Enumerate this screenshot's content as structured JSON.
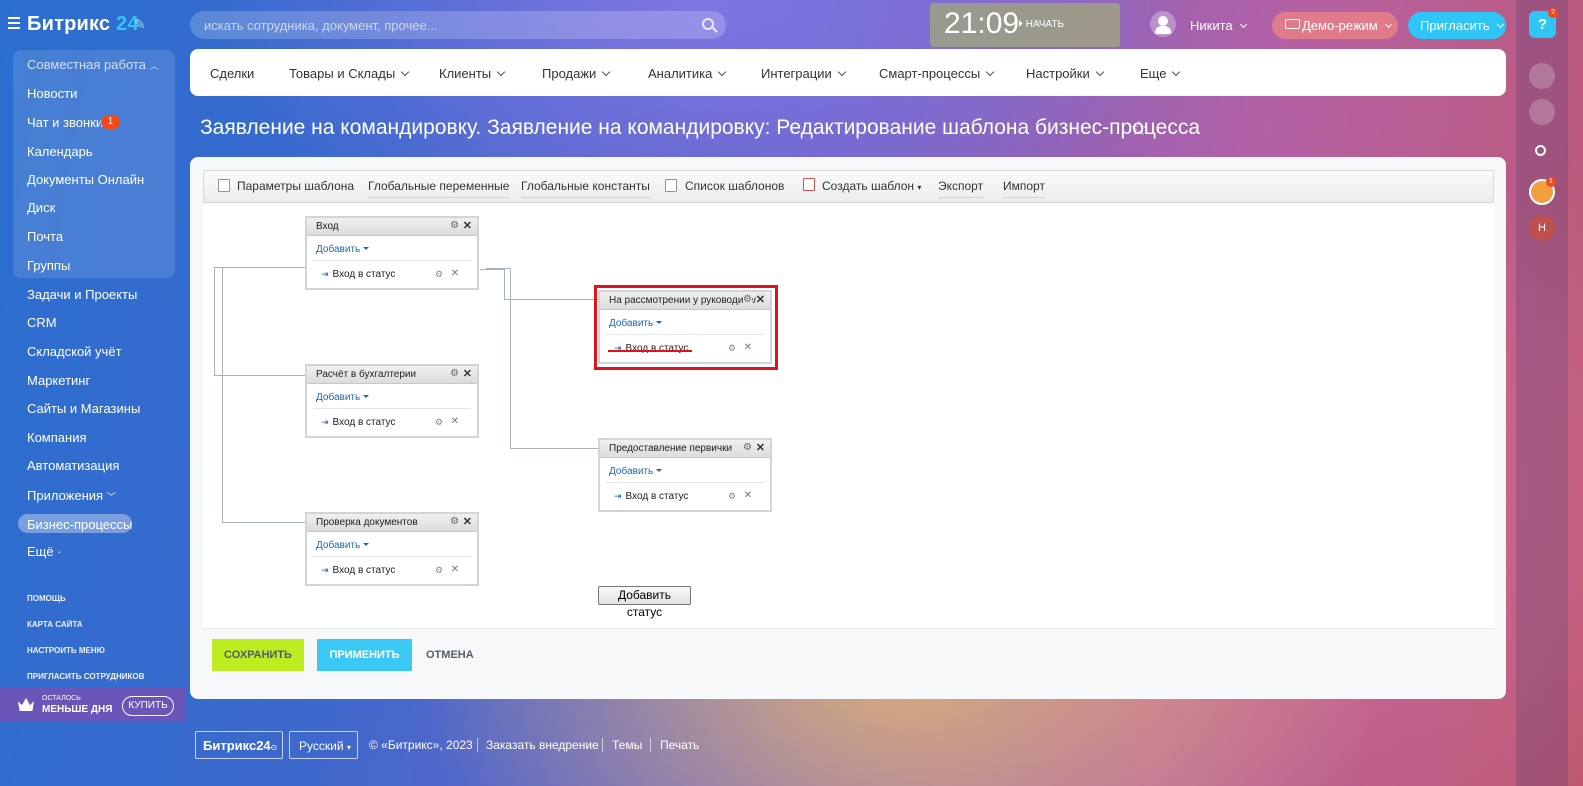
{
  "header": {
    "logo_main": "Битрикс",
    "logo_num": "24",
    "search_placeholder": "искать сотрудника, документ, прочее...",
    "clock": "21:09",
    "start_label": "НАЧАТЬ",
    "user_name": "Никита",
    "demo_label": "Демо-режим",
    "invite_label": "Пригласить"
  },
  "rail": {
    "help_count": "2",
    "avatar_count": "1",
    "avatar_initial": "Н"
  },
  "sidebar": {
    "group_label": "Совместная работа",
    "items": [
      "Новости",
      "Чат и звонки",
      "Календарь",
      "Документы Онлайн",
      "Диск",
      "Почта",
      "Группы",
      "Задачи и Проекты",
      "CRM",
      "Складской учёт",
      "Маркетинг",
      "Сайты и Магазины",
      "Компания",
      "Автоматизация",
      "Приложения",
      "Бизнес-процессы",
      "Ещё ·"
    ],
    "chat_count": "1",
    "footer_links": [
      "ПОМОЩЬ",
      "КАРТА САЙТА",
      "НАСТРОИТЬ МЕНЮ",
      "ПРИГЛАСИТЬ СОТРУДНИКОВ"
    ],
    "trial_small": "ОСТАЛОСЬ",
    "trial_big": "МЕНЬШЕ ДНЯ",
    "buy_label": "КУПИТЬ"
  },
  "nav": [
    "Сделки",
    "Товары и Склады",
    "Клиенты",
    "Продажи",
    "Аналитика",
    "Интеграции",
    "Смарт-процессы",
    "Настройки",
    "Еще"
  ],
  "page_title": "Заявление на командировку. Заявление на командировку: Редактирование шаблона бизнес-процесса",
  "toolbar": [
    "Параметры шаблона",
    "Глобальные переменные",
    "Глобальные константы",
    "Список шаблонов",
    "Создать шаблон",
    "Экспорт",
    "Импорт"
  ],
  "blocks": [
    {
      "title": "Вход",
      "add": "Добавить",
      "row": "Вход в статус"
    },
    {
      "title": "На рассмотрении у руководителя",
      "add": "Добавить",
      "row": "Вход в статус"
    },
    {
      "title": "Расчёт в бухгалтерии",
      "add": "Добавить",
      "row": "Вход в статус"
    },
    {
      "title": "Предоставление первички",
      "add": "Добавить",
      "row": "Вход в статус"
    },
    {
      "title": "Проверка документов",
      "add": "Добавить",
      "row": "Вход в статус"
    }
  ],
  "add_status_label": "Добавить статус",
  "actions": {
    "save": "СОХРАНИТЬ",
    "apply": "ПРИМЕНИТЬ",
    "cancel": "ОТМЕНА"
  },
  "footer": {
    "logo": "Битрикс24",
    "lang": "Русский",
    "copyright": "© «Битрикс», 2023",
    "order": "Заказать внедрение",
    "themes": "Темы",
    "print": "Печать"
  }
}
